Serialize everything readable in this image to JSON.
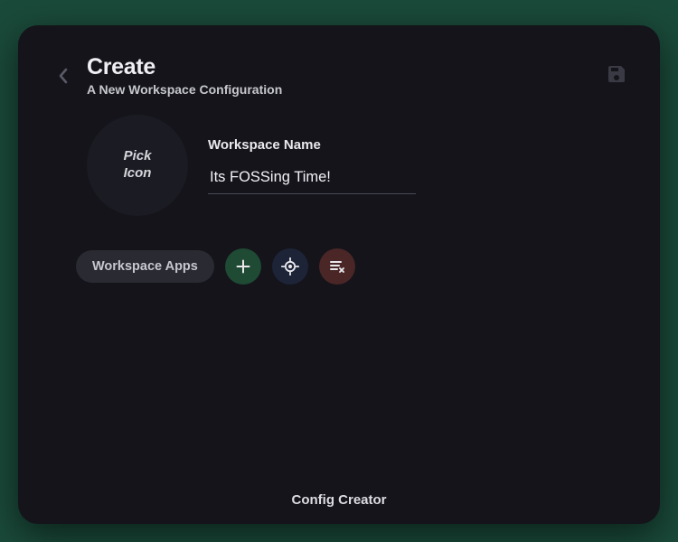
{
  "header": {
    "title": "Create",
    "subtitle": "A New Workspace Configuration"
  },
  "icon_picker": {
    "label": "Pick Icon"
  },
  "workspace_name": {
    "label": "Workspace Name",
    "value": "Its FOSSing Time!"
  },
  "apps": {
    "label": "Workspace Apps"
  },
  "footer": {
    "label": "Config Creator"
  },
  "colors": {
    "bg": "#14141a",
    "add": "#1f4a34",
    "target": "#1e2438",
    "remove": "#4a2626"
  }
}
